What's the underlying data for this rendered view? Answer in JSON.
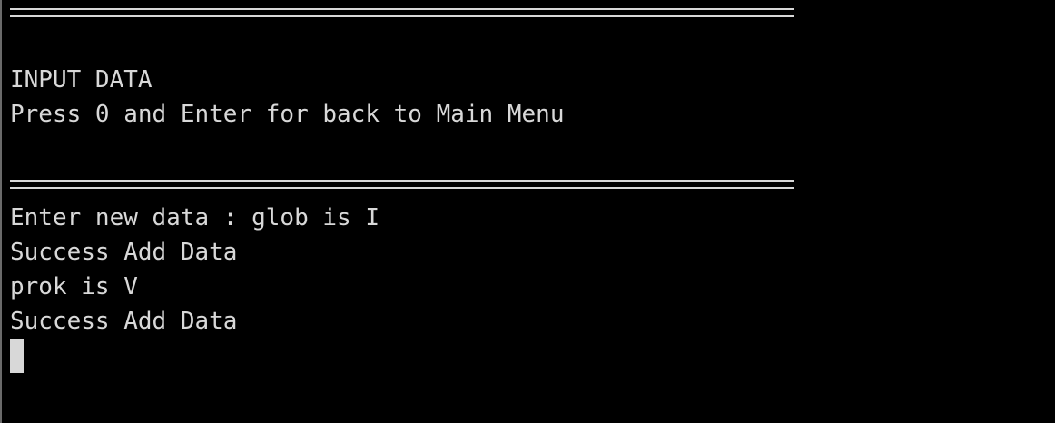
{
  "terminal": {
    "lines": [
      "INPUT DATA",
      "Press 0 and Enter for back to Main Menu",
      "Enter new data : glob is I",
      "Success Add Data",
      "prok is V",
      "Success Add Data"
    ]
  },
  "colors": {
    "background": "#000000",
    "foreground": "#d8d8d8"
  }
}
